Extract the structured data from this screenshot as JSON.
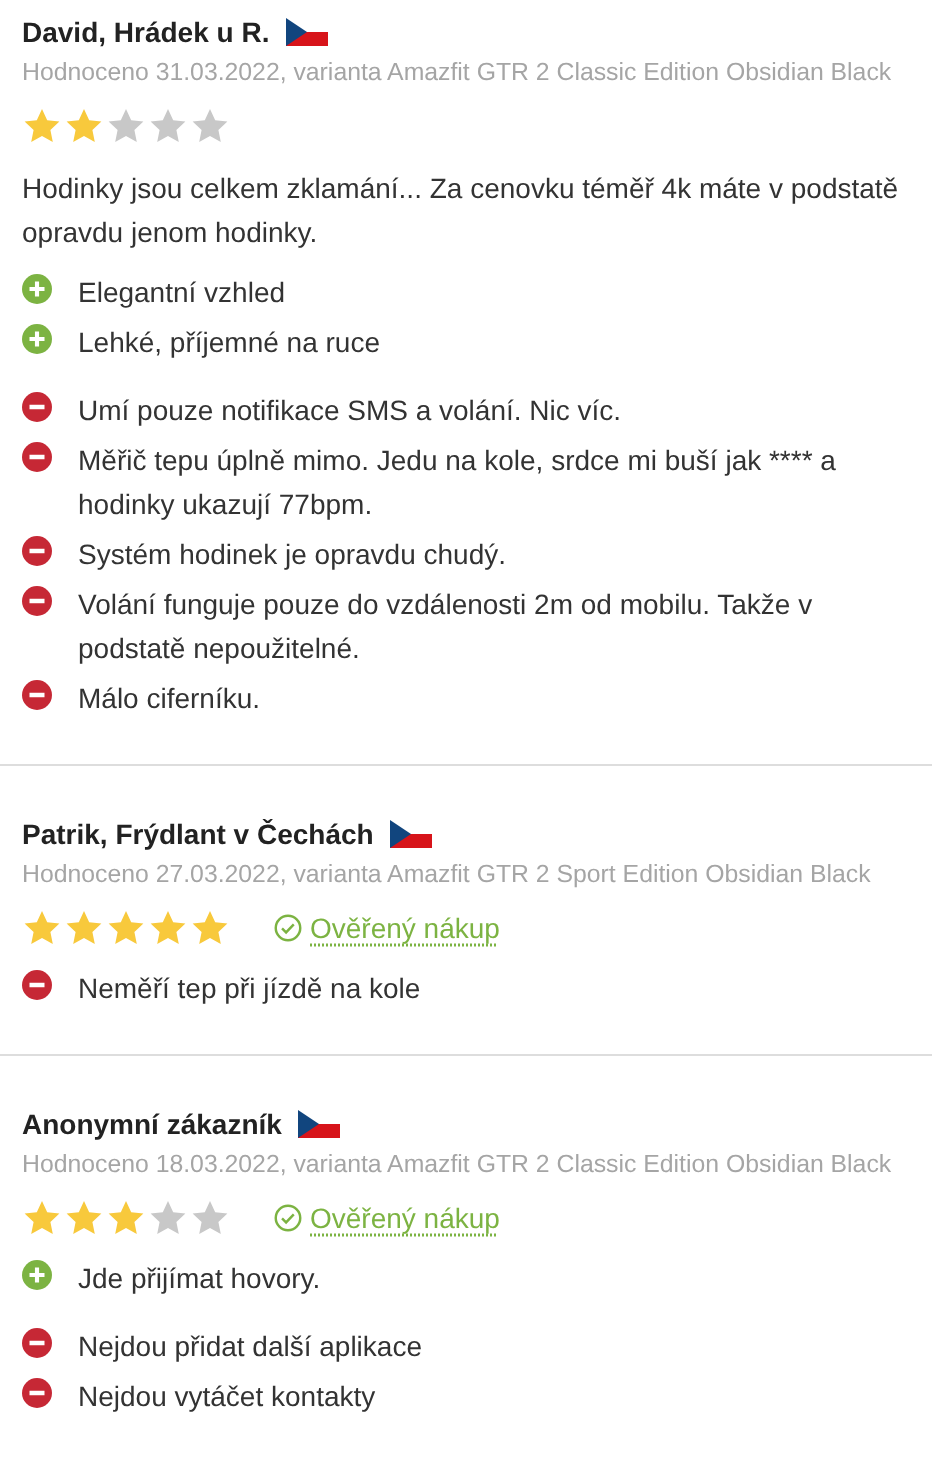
{
  "reviews": [
    {
      "author": "David, Hrádek u R.",
      "meta": "Hodnoceno 31.03.2022, varianta Amazfit GTR 2 Classic Edition Obsidian Black",
      "stars": 2,
      "text": "Hodinky jsou celkem zklamání... Za cenovku téměř 4k máte v podstatě opravdu jenom hodinky.",
      "pros": [
        "Elegantní vzhled",
        "Lehké, příjemné na ruce"
      ],
      "cons": [
        "Umí pouze notifikace SMS a volání. Nic víc.",
        "Měřič tepu úplně mimo. Jedu na kole, srdce mi buší jak **** a hodinky ukazují 77bpm.",
        "Systém hodinek je opravdu chudý.",
        "Volání funguje pouze do vzdálenosti 2m od mobilu. Takže v podstatě nepoužitelné.",
        "Málo ciferníku."
      ]
    },
    {
      "author": "Patrik, Frýdlant v Čechách",
      "meta": "Hodnoceno 27.03.2022, varianta Amazfit GTR 2 Sport Edition Obsidian Black",
      "stars": 5,
      "verified": "Ověřený nákup",
      "cons": [
        "Neměří tep při jízdě na kole"
      ]
    },
    {
      "author": "Anonymní zákazník",
      "meta": "Hodnoceno 18.03.2022, varianta Amazfit GTR 2 Classic Edition Obsidian Black",
      "stars": 3,
      "verified": "Ověřený nákup",
      "pros": [
        "Jde přijímat hovory."
      ],
      "cons": [
        "Nejdou přidat další aplikace",
        "Nejdou vytáčet kontakty"
      ]
    }
  ]
}
